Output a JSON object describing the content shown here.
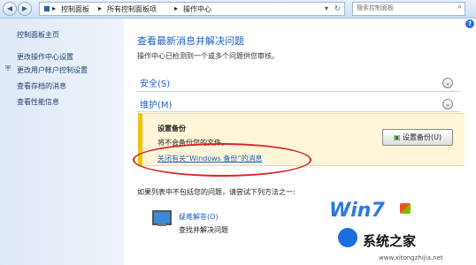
{
  "toolbar": {
    "back_icon": "arrow-left-icon",
    "forward_icon": "arrow-right-icon",
    "breadcrumb": [
      "控制面板",
      "所有控制面板项",
      "操作中心"
    ],
    "separator": "▸",
    "refresh_glyph": "↻",
    "search_placeholder": "搜索控制面板"
  },
  "sidebar": {
    "home": "控制面板主页",
    "items": [
      "更改操作中心设置",
      "更改用户帐户控制设置",
      "查看存档的消息",
      "查看性能信息"
    ]
  },
  "main": {
    "title": "查看最新消息并解决问题",
    "subtitle": "操作中心已检测到一个或多个问题供您审核。",
    "security": "安全(S)",
    "maintenance": "维护(M)",
    "notice": {
      "title": "设置备份",
      "desc": "将不会备份您的文件。",
      "link": "关闭有关“Windows 备份”的消息",
      "button": "设置备份(U)"
    },
    "footer_text": "如果列表中不包括您的问题，请尝试下列方法之一:",
    "troubleshoot": {
      "title": "疑难解答(O)",
      "desc": "查找并解决问题"
    }
  },
  "watermark": {
    "brand": "Win7",
    "site": "系统之家",
    "url": "www.xitongzhijia.net"
  },
  "colors": {
    "accent": "#1d5fbf",
    "notice_bar": "#f2c200",
    "notice_bg": "#fff6d9",
    "highlight": "#d9252a"
  }
}
